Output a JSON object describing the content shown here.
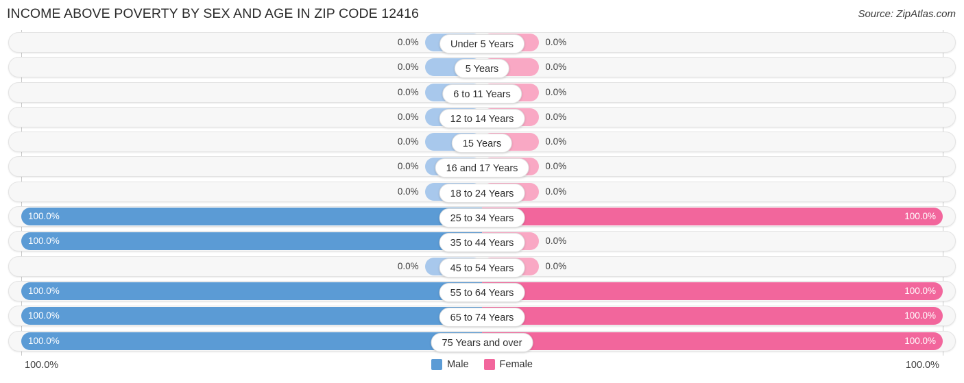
{
  "header": {
    "title": "INCOME ABOVE POVERTY BY SEX AND AGE IN ZIP CODE 12416",
    "source": "Source: ZipAtlas.com"
  },
  "footer": {
    "axis_min_label": "100.0%",
    "axis_max_label": "100.0%"
  },
  "legend": {
    "items": [
      {
        "label": "Male",
        "color": "#5b9bd5"
      },
      {
        "label": "Female",
        "color": "#f2669c"
      }
    ]
  },
  "colors": {
    "male_full": "#5b9bd5",
    "male_zero": "#a8c8ec",
    "female_full": "#f2669c",
    "female_zero": "#f9a8c4",
    "track": "#f7f7f7",
    "track_border": "#e3e3e3",
    "axis_line": "#c8c8c8"
  },
  "chart_data": {
    "type": "bar",
    "title": "INCOME ABOVE POVERTY BY SEX AND AGE IN ZIP CODE 12416",
    "subtitle": "Source: ZipAtlas.com",
    "orientation": "horizontal",
    "style": "diverging-bidirectional",
    "xlabel": "",
    "ylabel": "",
    "xlim": [
      0,
      100
    ],
    "grid": false,
    "legend_position": "bottom-center",
    "axis_min_label": "100.0%",
    "axis_max_label": "100.0%",
    "categories": [
      "Under 5 Years",
      "5 Years",
      "6 to 11 Years",
      "12 to 14 Years",
      "15 Years",
      "16 and 17 Years",
      "18 to 24 Years",
      "25 to 34 Years",
      "35 to 44 Years",
      "45 to 54 Years",
      "55 to 64 Years",
      "65 to 74 Years",
      "75 Years and over"
    ],
    "series": [
      {
        "name": "Male",
        "color": "#5b9bd5",
        "side": "left",
        "values": [
          0.0,
          0.0,
          0.0,
          0.0,
          0.0,
          0.0,
          0.0,
          100.0,
          100.0,
          0.0,
          100.0,
          100.0,
          100.0
        ],
        "labels": [
          "0.0%",
          "0.0%",
          "0.0%",
          "0.0%",
          "0.0%",
          "0.0%",
          "0.0%",
          "100.0%",
          "100.0%",
          "0.0%",
          "100.0%",
          "100.0%",
          "100.0%"
        ]
      },
      {
        "name": "Female",
        "color": "#f2669c",
        "side": "right",
        "values": [
          0.0,
          0.0,
          0.0,
          0.0,
          0.0,
          0.0,
          0.0,
          100.0,
          0.0,
          0.0,
          100.0,
          100.0,
          100.0
        ],
        "labels": [
          "0.0%",
          "0.0%",
          "0.0%",
          "0.0%",
          "0.0%",
          "0.0%",
          "0.0%",
          "100.0%",
          "0.0%",
          "0.0%",
          "100.0%",
          "100.0%",
          "100.0%"
        ]
      }
    ]
  }
}
